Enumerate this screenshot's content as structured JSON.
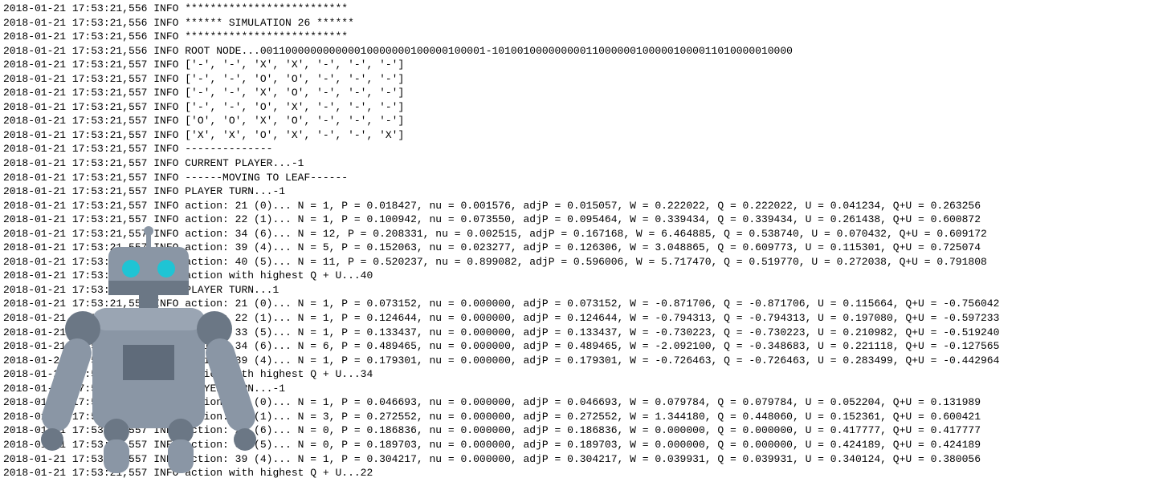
{
  "logLines": [
    "2018-01-21 17:53:21,556 INFO **************************",
    "2018-01-21 17:53:21,556 INFO ****** SIMULATION 26 ******",
    "2018-01-21 17:53:21,556 INFO **************************",
    "2018-01-21 17:53:21,556 INFO ROOT NODE...001100000000000010000000100000100001-101001000000000110000001000001000011010000010000",
    "2018-01-21 17:53:21,557 INFO ['-', '-', 'X', 'X', '-', '-', '-']",
    "2018-01-21 17:53:21,557 INFO ['-', '-', 'O', 'O', '-', '-', '-']",
    "2018-01-21 17:53:21,557 INFO ['-', '-', 'X', 'O', '-', '-', '-']",
    "2018-01-21 17:53:21,557 INFO ['-', '-', 'O', 'X', '-', '-', '-']",
    "2018-01-21 17:53:21,557 INFO ['O', 'O', 'X', 'O', '-', '-', '-']",
    "2018-01-21 17:53:21,557 INFO ['X', 'X', 'O', 'X', '-', '-', 'X']",
    "2018-01-21 17:53:21,557 INFO --------------",
    "2018-01-21 17:53:21,557 INFO CURRENT PLAYER...-1",
    "2018-01-21 17:53:21,557 INFO ------MOVING TO LEAF------",
    "2018-01-21 17:53:21,557 INFO PLAYER TURN...-1",
    "2018-01-21 17:53:21,557 INFO action: 21 (0)... N = 1, P = 0.018427, nu = 0.001576, adjP = 0.015057, W = 0.222022, Q = 0.222022, U = 0.041234, Q+U = 0.263256",
    "2018-01-21 17:53:21,557 INFO action: 22 (1)... N = 1, P = 0.100942, nu = 0.073550, adjP = 0.095464, W = 0.339434, Q = 0.339434, U = 0.261438, Q+U = 0.600872",
    "2018-01-21 17:53:21,557 INFO action: 34 (6)... N = 12, P = 0.208331, nu = 0.002515, adjP = 0.167168, W = 6.464885, Q = 0.538740, U = 0.070432, Q+U = 0.609172",
    "2018-01-21 17:53:21,557 INFO action: 39 (4)... N = 5, P = 0.152063, nu = 0.023277, adjP = 0.126306, W = 3.048865, Q = 0.609773, U = 0.115301, Q+U = 0.725074",
    "2018-01-21 17:53:21,557 INFO action: 40 (5)... N = 11, P = 0.520237, nu = 0.899082, adjP = 0.596006, W = 5.717470, Q = 0.519770, U = 0.272038, Q+U = 0.791808",
    "2018-01-21 17:53:21,557 INFO action with highest Q + U...40",
    "2018-01-21 17:53:21,557 INFO PLAYER TURN...1",
    "2018-01-21 17:53:21,557 INFO action: 21 (0)... N = 1, P = 0.073152, nu = 0.000000, adjP = 0.073152, W = -0.871706, Q = -0.871706, U = 0.115664, Q+U = -0.756042",
    "2018-01-21 17:53:21,557 INFO action: 22 (1)... N = 1, P = 0.124644, nu = 0.000000, adjP = 0.124644, W = -0.794313, Q = -0.794313, U = 0.197080, Q+U = -0.597233",
    "2018-01-21 17:53:21,557 INFO action: 33 (5)... N = 1, P = 0.133437, nu = 0.000000, adjP = 0.133437, W = -0.730223, Q = -0.730223, U = 0.210982, Q+U = -0.519240",
    "2018-01-21 17:53:21,557 INFO action: 34 (6)... N = 6, P = 0.489465, nu = 0.000000, adjP = 0.489465, W = -2.092100, Q = -0.348683, U = 0.221118, Q+U = -0.127565",
    "2018-01-21 17:53:21,557 INFO action: 39 (4)... N = 1, P = 0.179301, nu = 0.000000, adjP = 0.179301, W = -0.726463, Q = -0.726463, U = 0.283499, Q+U = -0.442964",
    "2018-01-21 17:53:21,557 INFO action with highest Q + U...34",
    "2018-01-21 17:53:21,557 INFO PLAYER TURN...-1",
    "2018-01-21 17:53:21,557 INFO action: 21 (0)... N = 1, P = 0.046693, nu = 0.000000, adjP = 0.046693, W = 0.079784, Q = 0.079784, U = 0.052204, Q+U = 0.131989",
    "2018-01-21 17:53:21,557 INFO action: 22 (1)... N = 3, P = 0.272552, nu = 0.000000, adjP = 0.272552, W = 1.344180, Q = 0.448060, U = 0.152361, Q+U = 0.600421",
    "2018-01-21 17:53:21,557 INFO action: 27 (6)... N = 0, P = 0.186836, nu = 0.000000, adjP = 0.186836, W = 0.000000, Q = 0.000000, U = 0.417777, Q+U = 0.417777",
    "2018-01-21 17:53:21,557 INFO action: 33 (5)... N = 0, P = 0.189703, nu = 0.000000, adjP = 0.189703, W = 0.000000, Q = 0.000000, U = 0.424189, Q+U = 0.424189",
    "2018-01-21 17:53:21,557 INFO action: 39 (4)... N = 1, P = 0.304217, nu = 0.000000, adjP = 0.304217, W = 0.039931, Q = 0.039931, U = 0.340124, Q+U = 0.380056",
    "2018-01-21 17:53:21,557 INFO action with highest Q + U...22"
  ],
  "robot": {
    "bodyColor": "#8a96a5",
    "bodyColorLight": "#9aa5b3",
    "bodyColorDark": "#6b7785",
    "eyeColor": "#1fc4d4",
    "screenColor": "#5f6b7a"
  }
}
